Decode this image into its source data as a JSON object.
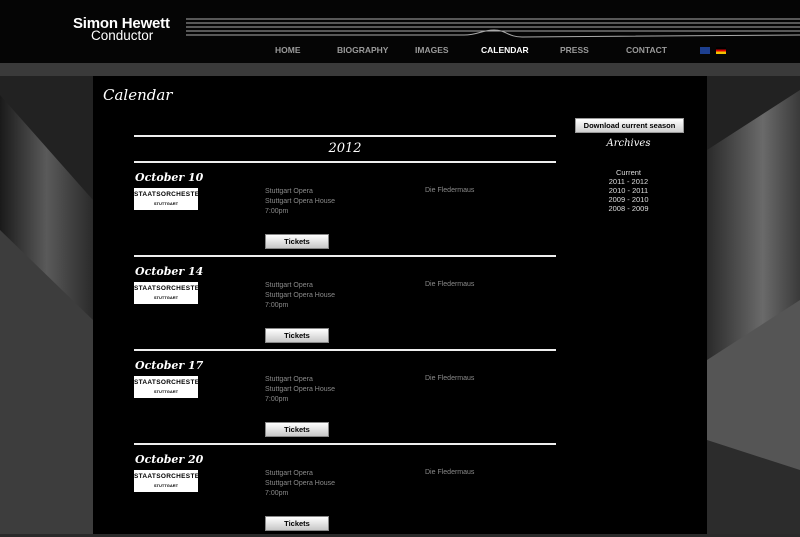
{
  "header": {
    "name": "Simon Hewett",
    "role": "Conductor"
  },
  "nav": {
    "items": [
      {
        "label": "HOME"
      },
      {
        "label": "BIOGRAPHY"
      },
      {
        "label": "IMAGES"
      },
      {
        "label": "CALENDAR"
      },
      {
        "label": "PRESS"
      },
      {
        "label": "CONTACT"
      }
    ],
    "active": "CALENDAR",
    "languages": [
      "english-flag-icon",
      "german-flag-icon"
    ]
  },
  "page": {
    "title": "Calendar"
  },
  "calendar": {
    "year": "2012",
    "events": [
      {
        "date": "October 10",
        "logo_line1": "STAATSORCHESTER",
        "logo_line2": "STUTTGART",
        "venue": "Stuttgart Opera",
        "hall": "Stuttgart Opera House",
        "time": "7:00pm",
        "work": "Die Fledermaus",
        "tickets_label": "Tickets"
      },
      {
        "date": "October 14",
        "logo_line1": "STAATSORCHESTER",
        "logo_line2": "STUTTGART",
        "venue": "Stuttgart Opera",
        "hall": "Stuttgart Opera House",
        "time": "7:00pm",
        "work": "Die Fledermaus",
        "tickets_label": "Tickets"
      },
      {
        "date": "October 17",
        "logo_line1": "STAATSORCHESTER",
        "logo_line2": "STUTTGART",
        "venue": "Stuttgart Opera",
        "hall": "Stuttgart Opera House",
        "time": "7:00pm",
        "work": "Die Fledermaus",
        "tickets_label": "Tickets"
      },
      {
        "date": "October 20",
        "logo_line1": "STAATSORCHESTER",
        "logo_line2": "STUTTGART",
        "venue": "Stuttgart Opera",
        "hall": "Stuttgart Opera House",
        "time": "7:00pm",
        "work": "Die Fledermaus",
        "tickets_label": "Tickets"
      }
    ]
  },
  "sidebar": {
    "download_label": "Download current season",
    "archives_title": "Archives",
    "archives": [
      "Current",
      "2011 - 2012",
      "2010 - 2011",
      "2009 - 2010",
      "2008 - 2009"
    ]
  }
}
